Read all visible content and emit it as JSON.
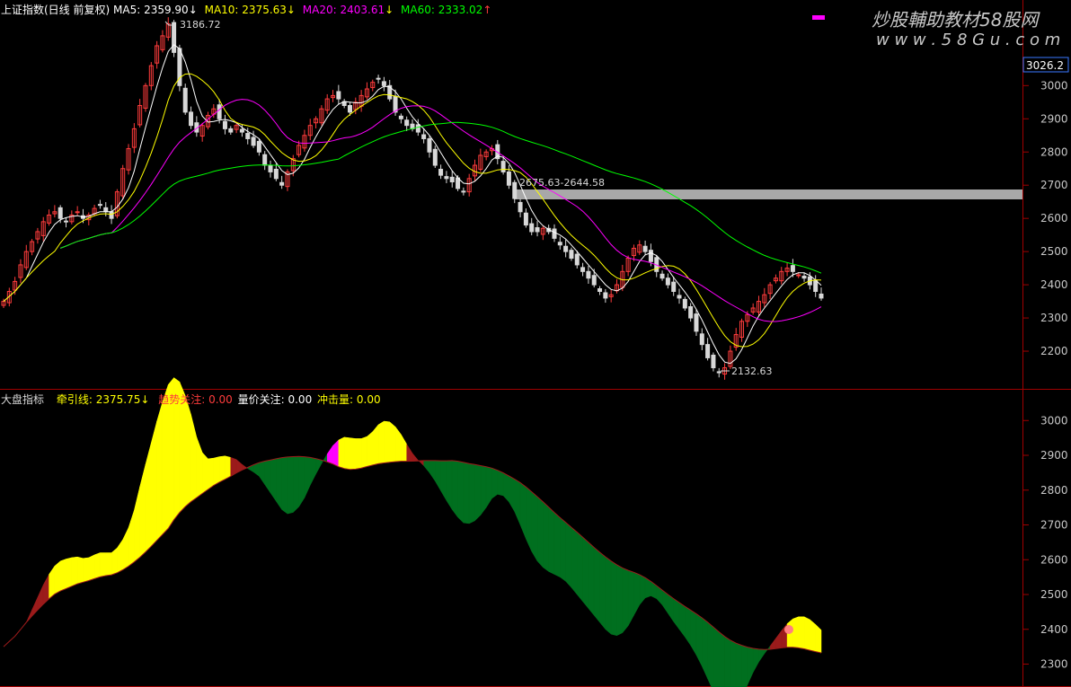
{
  "header_upper": {
    "title": "上证指数(日线 前复权)",
    "ma5": "MA5: 2359.90",
    "ma10": "MA10: 2375.63",
    "ma20": "MA20: 2403.61",
    "ma60": "MA60: 2333.02",
    "arrow_down": "↓",
    "arrow_up": "↑"
  },
  "header_lower": {
    "title": "大盘指标",
    "traction": "牵引线: 2375.75",
    "trend": "趋势关注: 0.00",
    "volprice": "量价关注: 0.00",
    "impact": "冲击量: 0.00",
    "arrow_down": "↓"
  },
  "watermark": {
    "title": "炒股輔助教材58股网",
    "url": "w w w . 5 8 G u . c o m"
  },
  "annotations": {
    "high": "3186.72",
    "low": "2132.63",
    "band": "2675.63-2644.58",
    "current_price": "3026.2"
  },
  "colors": {
    "up": "#ff3c3c",
    "down": "#d8d8d8",
    "ma5": "#ffffff",
    "ma10": "#ffff00",
    "ma20": "#ff00ff",
    "ma60": "#00ff00",
    "axis_red": "#a00000",
    "band": "#a8a8a8",
    "fill_red": "#9b1b1b",
    "fill_yellow": "#ffff00",
    "fill_magenta": "#ff00ff",
    "fill_green": "#006f1f"
  },
  "chart_data": [
    {
      "type": "candlestick",
      "panel": "upper",
      "ylim": [
        2100,
        3220
      ],
      "yticks": [
        2200,
        2300,
        2400,
        2500,
        2600,
        2700,
        2800,
        2900,
        3000
      ],
      "band": [
        2644.58,
        2675.63
      ],
      "series_close": [
        2350,
        2380,
        2410,
        2460,
        2500,
        2530,
        2560,
        2590,
        2610,
        2620,
        2600,
        2590,
        2610,
        2620,
        2600,
        2610,
        2630,
        2640,
        2620,
        2600,
        2680,
        2750,
        2810,
        2870,
        2940,
        3000,
        3060,
        3120,
        3150,
        3186,
        3100,
        3000,
        2920,
        2880,
        2860,
        2880,
        2910,
        2930,
        2900,
        2870,
        2860,
        2880,
        2860,
        2840,
        2820,
        2800,
        2760,
        2740,
        2720,
        2700,
        2740,
        2780,
        2820,
        2850,
        2880,
        2900,
        2930,
        2960,
        2970,
        2960,
        2940,
        2920,
        2950,
        2970,
        2990,
        3010,
        3020,
        3000,
        2960,
        2920,
        2900,
        2880,
        2870,
        2860,
        2840,
        2800,
        2760,
        2730,
        2720,
        2710,
        2690,
        2680,
        2720,
        2760,
        2790,
        2800,
        2810,
        2780,
        2740,
        2700,
        2660,
        2620,
        2580,
        2560,
        2560,
        2570,
        2560,
        2540,
        2520,
        2500,
        2480,
        2460,
        2440,
        2420,
        2400,
        2380,
        2360,
        2370,
        2400,
        2440,
        2480,
        2510,
        2520,
        2500,
        2470,
        2440,
        2420,
        2400,
        2380,
        2360,
        2330,
        2300,
        2260,
        2220,
        2180,
        2150,
        2135,
        2150,
        2200,
        2250,
        2290,
        2310,
        2330,
        2350,
        2370,
        2400,
        2420,
        2440,
        2450,
        2440,
        2430,
        2420,
        2400,
        2380,
        2360
      ],
      "ma5_last": 2359.9,
      "ma10_last": 2375.63,
      "ma20_last": 2403.61,
      "ma60_last": 2333.02,
      "high": 3186.72,
      "low": 2132.63
    },
    {
      "type": "area",
      "panel": "lower",
      "ylim": [
        2260,
        3060
      ],
      "yticks": [
        2300,
        2400,
        2500,
        2600,
        2700,
        2800,
        2900,
        3000
      ],
      "traction_last": 2375.75
    }
  ]
}
